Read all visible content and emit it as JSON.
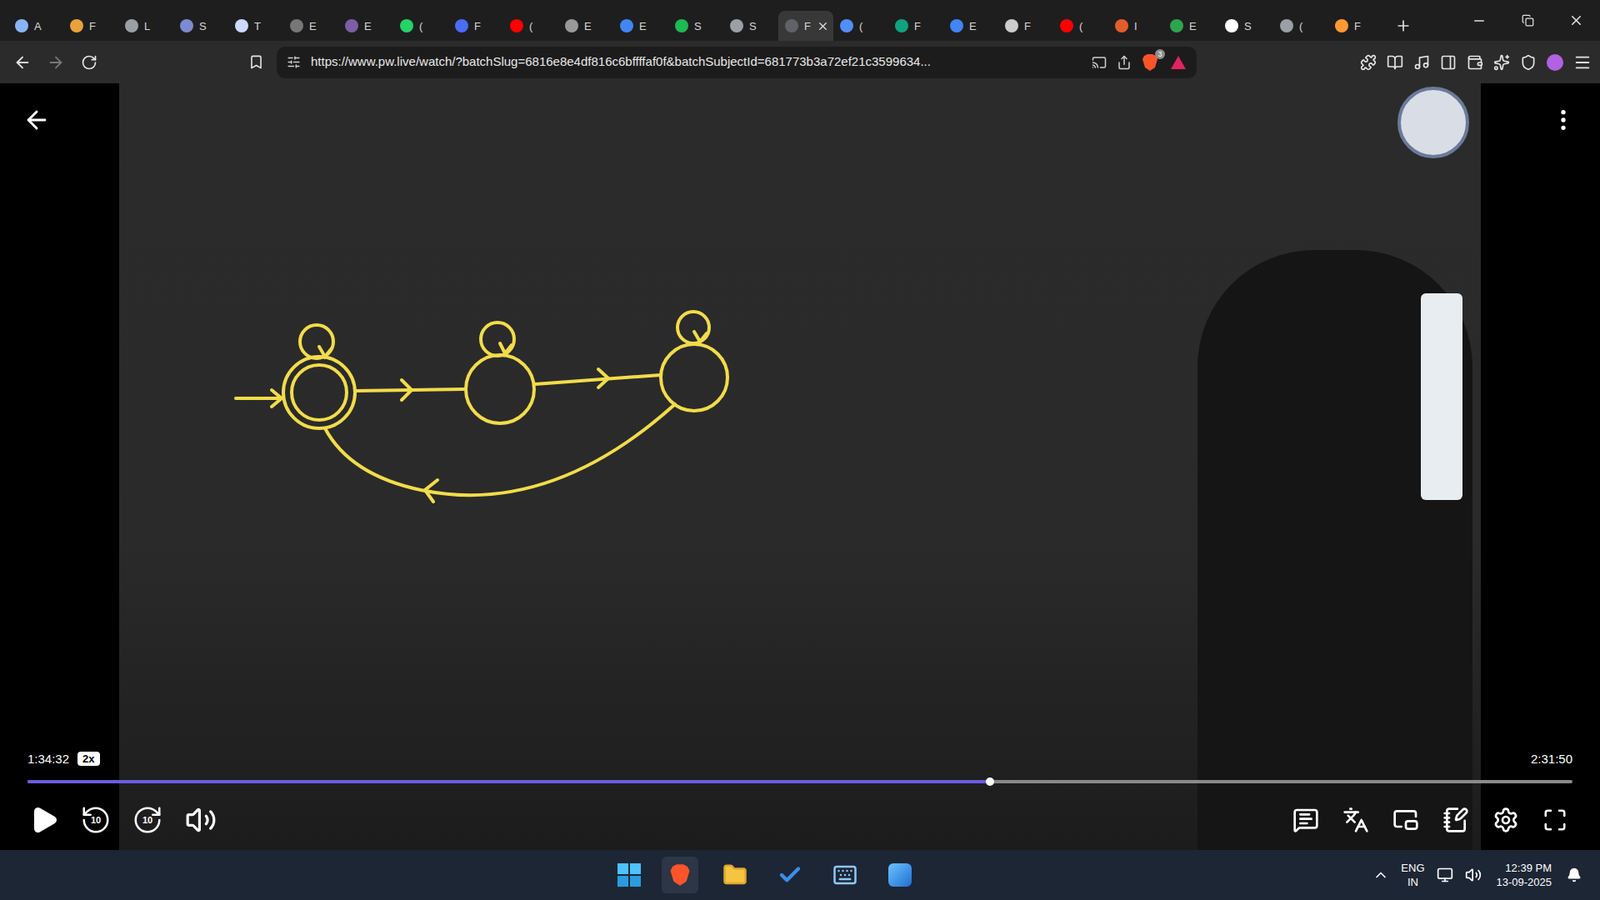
{
  "browser": {
    "tabs": [
      {
        "label": "A",
        "selected": false,
        "color": "#8ab4f8"
      },
      {
        "label": "F",
        "selected": false,
        "color": "#e8a33d"
      },
      {
        "label": "L",
        "selected": false,
        "color": "#9aa0a6"
      },
      {
        "label": "S",
        "selected": false,
        "color": "#7c8bd0"
      },
      {
        "label": "T",
        "selected": false,
        "color": "#cfd8ff"
      },
      {
        "label": "E",
        "selected": false,
        "color": "#777777"
      },
      {
        "label": "E",
        "selected": false,
        "color": "#7b5ea7"
      },
      {
        "label": "(",
        "selected": false,
        "color": "#25d366"
      },
      {
        "label": "F",
        "selected": false,
        "color": "#4a6cf7"
      },
      {
        "label": "(",
        "selected": false,
        "color": "#ff0000"
      },
      {
        "label": "E",
        "selected": false,
        "color": "#999999"
      },
      {
        "label": "E",
        "selected": false,
        "color": "#4285f4"
      },
      {
        "label": "S",
        "selected": false,
        "color": "#1db954"
      },
      {
        "label": "S",
        "selected": false,
        "color": "#9aa0a6"
      },
      {
        "label": "F",
        "selected": true,
        "color": "#5f6368"
      },
      {
        "label": "(",
        "selected": false,
        "color": "#4f8ff7"
      },
      {
        "label": "F",
        "selected": false,
        "color": "#10a37f"
      },
      {
        "label": "E",
        "selected": false,
        "color": "#4285f4"
      },
      {
        "label": "F",
        "selected": false,
        "color": "#cccccc"
      },
      {
        "label": "(",
        "selected": false,
        "color": "#ff0000"
      },
      {
        "label": "I",
        "selected": false,
        "color": "#e35d2b"
      },
      {
        "label": "E",
        "selected": false,
        "color": "#2ea44f"
      },
      {
        "label": "S",
        "selected": false,
        "color": "#ffffff"
      },
      {
        "label": "(",
        "selected": false,
        "color": "#9aa0a6"
      },
      {
        "label": "F",
        "selected": false,
        "color": "#ff9933"
      }
    ],
    "url": "https://www.pw.live/watch/?batchSlug=6816e8e4df816c6bffffaf0f&batchSubjectId=681773b3a72ef21c3599634...",
    "extension_badge": "3"
  },
  "player": {
    "current_time": "1:34:32",
    "speed": "2x",
    "duration": "2:31:50",
    "level": 0.623,
    "playing": false,
    "skip_back": "10",
    "skip_forward": "10"
  },
  "taskbar": {
    "language": "ENG",
    "region": "IN",
    "time": "12:39 PM",
    "date": "13-09-2025"
  }
}
